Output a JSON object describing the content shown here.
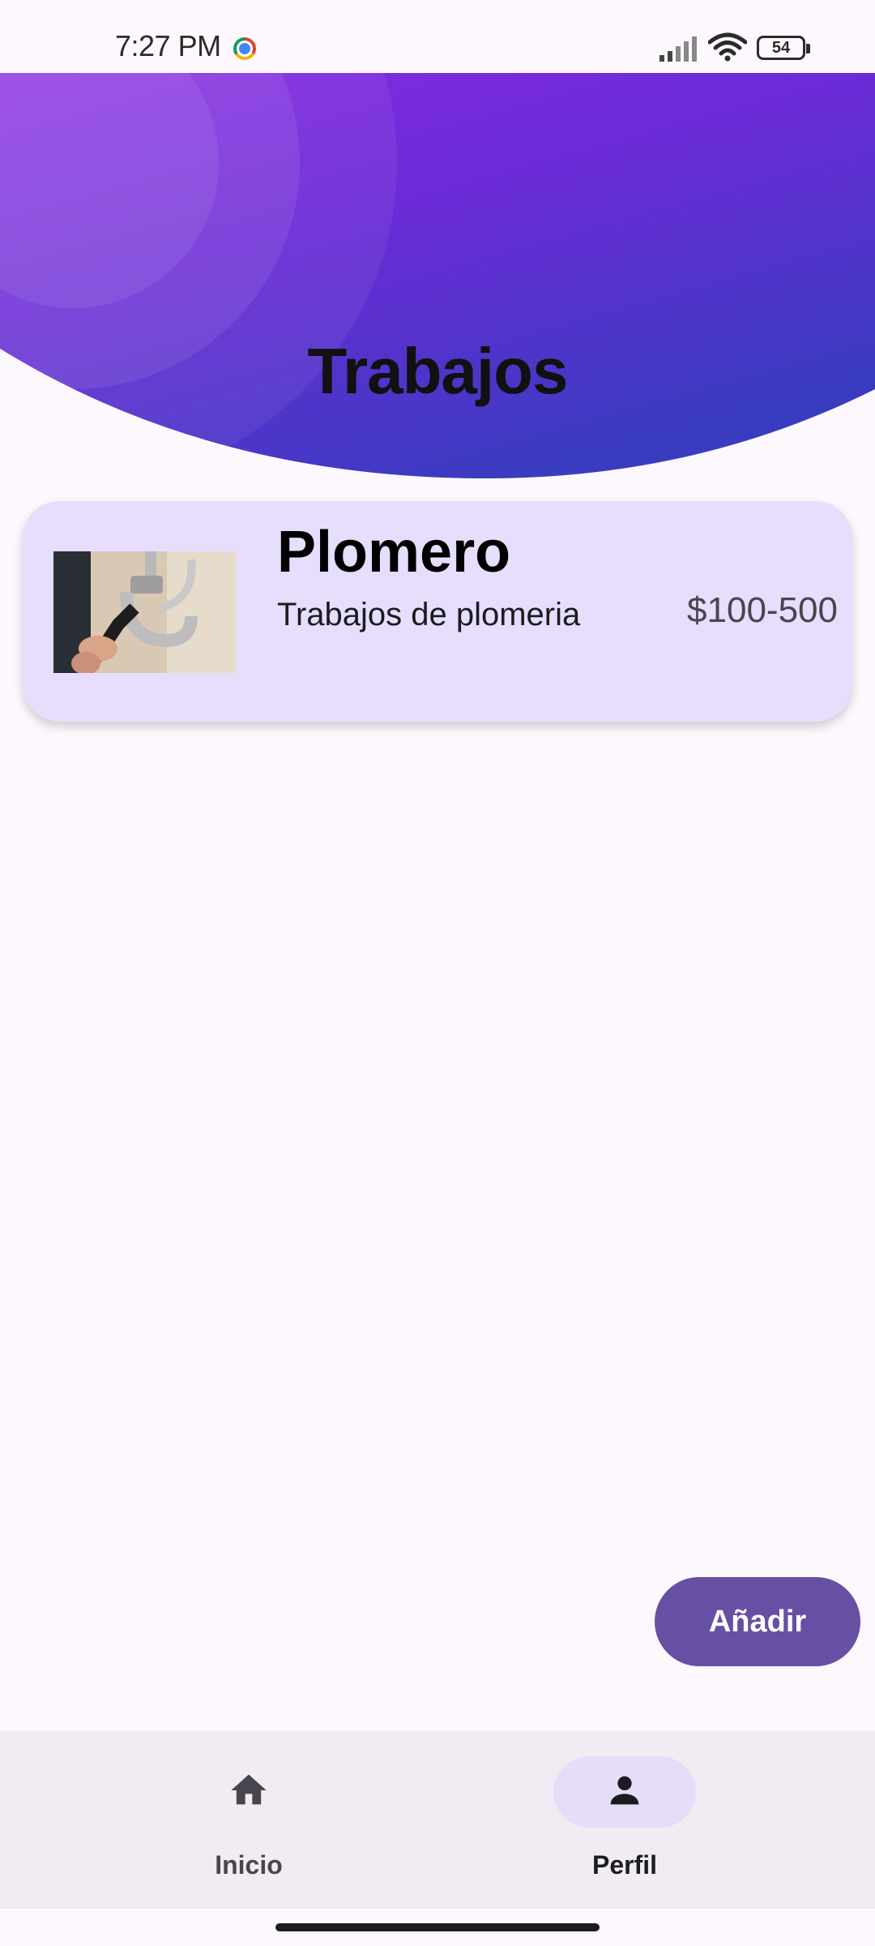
{
  "status_bar": {
    "time": "7:27 PM",
    "battery": "54",
    "icons": [
      "chrome-icon",
      "signal-icon",
      "wifi-icon",
      "battery-icon"
    ]
  },
  "header": {
    "title": "Trabajos",
    "gradient_colors": [
      "#7B2CD8",
      "#3B3DC1"
    ]
  },
  "jobs": [
    {
      "title": "Plomero",
      "description": "Trabajos de plomeria",
      "price": "$100-500",
      "image": "plumbing-photo"
    }
  ],
  "fab": {
    "label": "Añadir"
  },
  "bottom_nav": {
    "items": [
      {
        "label": "Inicio",
        "icon": "home-icon",
        "active": false
      },
      {
        "label": "Perfil",
        "icon": "person-icon",
        "active": true
      }
    ]
  },
  "colors": {
    "background": "#FDF8FD",
    "card": "#E6DEFC",
    "primary": "#6750A4",
    "nav_bar": "#F1ECF4",
    "nav_active_pill": "#E6DEF8"
  }
}
